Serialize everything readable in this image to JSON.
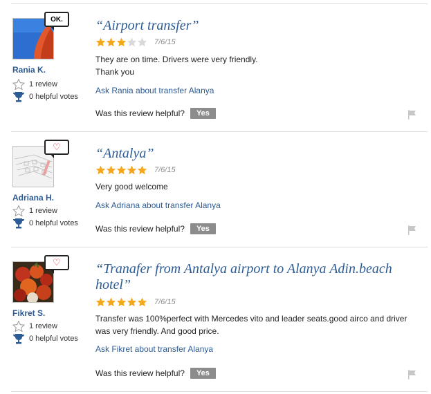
{
  "reviews": [
    {
      "username": "Rania K.",
      "badge": "OK.",
      "review_count": "1 review",
      "helpful_votes": "0 helpful votes",
      "title": "“Airport transfer”",
      "rating": 3,
      "date": "7/6/15",
      "body_lines": [
        "They are on time. Drivers were very friendly.",
        "Thank you"
      ],
      "ask_link": "Ask Rania about transfer Alanya",
      "helpful_question": "Was this review helpful?",
      "yes_label": "Yes"
    },
    {
      "username": "Adriana H.",
      "badge": "♡",
      "review_count": "1 review",
      "helpful_votes": "0 helpful votes",
      "title": "“Antalya”",
      "rating": 5,
      "date": "7/6/15",
      "body_lines": [
        "Very good welcome"
      ],
      "ask_link": "Ask Adriana about transfer Alanya",
      "helpful_question": "Was this review helpful?",
      "yes_label": "Yes"
    },
    {
      "username": "Fikret S.",
      "badge": "♡",
      "review_count": "1 review",
      "helpful_votes": "0 helpful votes",
      "title": "“Tranafer from Antalya airport to Alanya Adin.beach hotel”",
      "rating": 5,
      "date": "7/6/15",
      "body_lines": [
        "Transfer was 100%perfect with Mercedes vito and leader seats.good airco and driver",
        "was very friendly. And good price."
      ],
      "ask_link": "Ask Fikret about transfer Alanya",
      "helpful_question": "Was this review helpful?",
      "yes_label": "Yes"
    }
  ],
  "colors": {
    "link": "#2d5b94",
    "star": "#f5a81c",
    "star_empty": "#d9d9d9",
    "button": "#8c8c8c"
  },
  "icons": {
    "star": "star-icon",
    "review": "review-star-outline-icon",
    "votes": "trophy-icon",
    "flag": "flag-icon"
  }
}
